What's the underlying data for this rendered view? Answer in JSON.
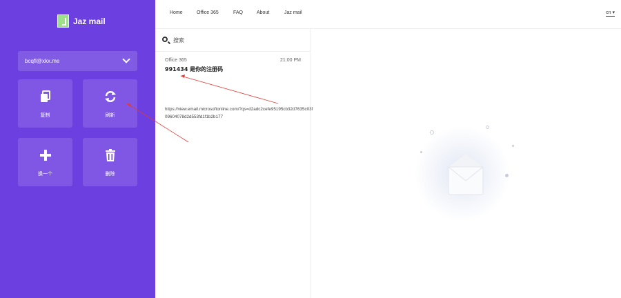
{
  "brand": {
    "name": "Jaz mail"
  },
  "account": {
    "email": "bcqfl@xkx.me"
  },
  "actions": [
    {
      "label": "复制",
      "icon": "copy-icon"
    },
    {
      "label": "刷新",
      "icon": "refresh-icon"
    },
    {
      "label": "换一个",
      "icon": "plus-icon"
    },
    {
      "label": "删除",
      "icon": "trash-icon"
    }
  ],
  "nav": {
    "items": [
      "Home",
      "Office 365",
      "FAQ",
      "About",
      "Jaz mail"
    ],
    "language": "cn"
  },
  "search": {
    "placeholder": "搜索"
  },
  "messages": [
    {
      "sender": "Office 365",
      "time": "21:00 PM",
      "subject": "991434 是你的注册码",
      "body": "https://view.email.microsoftonline.com/?qs=d2adc2cefe95195cb32d7635c03f09604078d2d553fd1f1b2b177"
    }
  ],
  "colors": {
    "sidebar": "#6c3fe0",
    "logo_accent": "#9fe08a",
    "annotation": "#e53935"
  }
}
